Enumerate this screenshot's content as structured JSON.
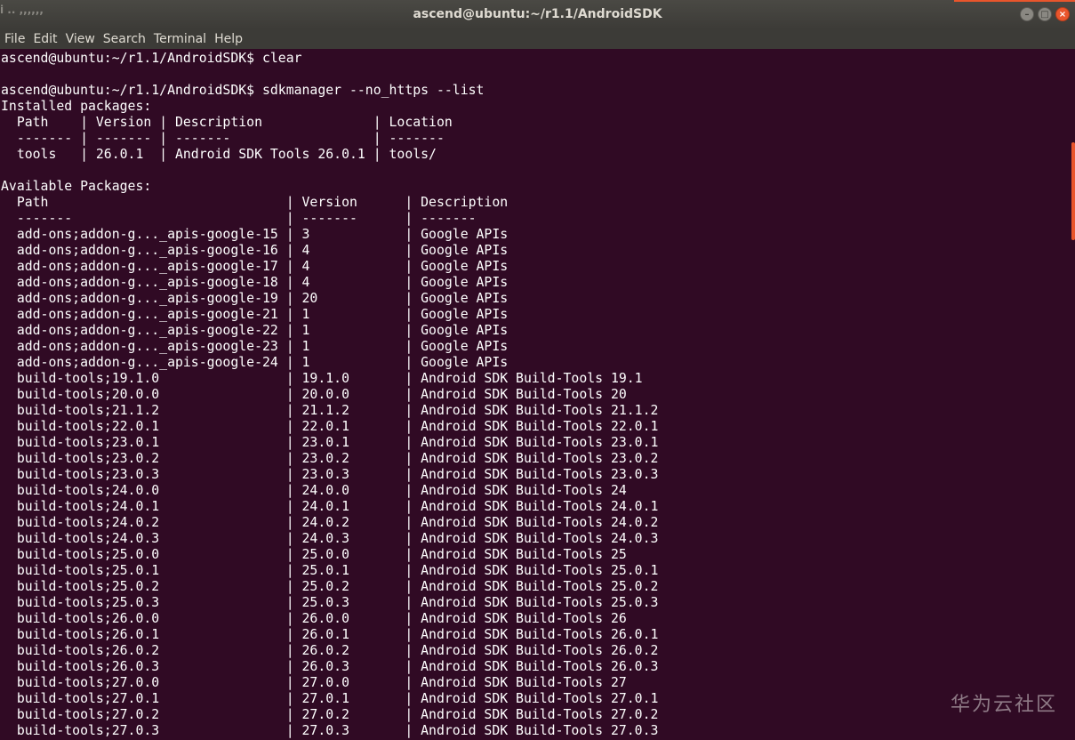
{
  "window": {
    "title": "ascend@ubuntu:~/r1.1/AndroidSDK",
    "corner_fragment": "i  .. ,,,,,,",
    "controls": {
      "minimize": "–",
      "maximize": "□",
      "close": "×"
    }
  },
  "menu": [
    "File",
    "Edit",
    "View",
    "Search",
    "Terminal",
    "Help"
  ],
  "terminal": {
    "lines": [
      "ascend@ubuntu:~/r1.1/AndroidSDK$ clear",
      "",
      "ascend@ubuntu:~/r1.1/AndroidSDK$ sdkmanager --no_https --list",
      "Installed packages:",
      "  Path    | Version | Description              | Location",
      "  ------- | ------- | -------                  | -------",
      "  tools   | 26.0.1  | Android SDK Tools 26.0.1 | tools/",
      "",
      "Available Packages:",
      "  Path                              | Version      | Description",
      "  -------                           | -------      | -------",
      "  add-ons;addon-g..._apis-google-15 | 3            | Google APIs",
      "  add-ons;addon-g..._apis-google-16 | 4            | Google APIs",
      "  add-ons;addon-g..._apis-google-17 | 4            | Google APIs",
      "  add-ons;addon-g..._apis-google-18 | 4            | Google APIs",
      "  add-ons;addon-g..._apis-google-19 | 20           | Google APIs",
      "  add-ons;addon-g..._apis-google-21 | 1            | Google APIs",
      "  add-ons;addon-g..._apis-google-22 | 1            | Google APIs",
      "  add-ons;addon-g..._apis-google-23 | 1            | Google APIs",
      "  add-ons;addon-g..._apis-google-24 | 1            | Google APIs",
      "  build-tools;19.1.0                | 19.1.0       | Android SDK Build-Tools 19.1",
      "  build-tools;20.0.0                | 20.0.0       | Android SDK Build-Tools 20",
      "  build-tools;21.1.2                | 21.1.2       | Android SDK Build-Tools 21.1.2",
      "  build-tools;22.0.1                | 22.0.1       | Android SDK Build-Tools 22.0.1",
      "  build-tools;23.0.1                | 23.0.1       | Android SDK Build-Tools 23.0.1",
      "  build-tools;23.0.2                | 23.0.2       | Android SDK Build-Tools 23.0.2",
      "  build-tools;23.0.3                | 23.0.3       | Android SDK Build-Tools 23.0.3",
      "  build-tools;24.0.0                | 24.0.0       | Android SDK Build-Tools 24",
      "  build-tools;24.0.1                | 24.0.1       | Android SDK Build-Tools 24.0.1",
      "  build-tools;24.0.2                | 24.0.2       | Android SDK Build-Tools 24.0.2",
      "  build-tools;24.0.3                | 24.0.3       | Android SDK Build-Tools 24.0.3",
      "  build-tools;25.0.0                | 25.0.0       | Android SDK Build-Tools 25",
      "  build-tools;25.0.1                | 25.0.1       | Android SDK Build-Tools 25.0.1",
      "  build-tools;25.0.2                | 25.0.2       | Android SDK Build-Tools 25.0.2",
      "  build-tools;25.0.3                | 25.0.3       | Android SDK Build-Tools 25.0.3",
      "  build-tools;26.0.0                | 26.0.0       | Android SDK Build-Tools 26",
      "  build-tools;26.0.1                | 26.0.1       | Android SDK Build-Tools 26.0.1",
      "  build-tools;26.0.2                | 26.0.2       | Android SDK Build-Tools 26.0.2",
      "  build-tools;26.0.3                | 26.0.3       | Android SDK Build-Tools 26.0.3",
      "  build-tools;27.0.0                | 27.0.0       | Android SDK Build-Tools 27",
      "  build-tools;27.0.1                | 27.0.1       | Android SDK Build-Tools 27.0.1",
      "  build-tools;27.0.2                | 27.0.2       | Android SDK Build-Tools 27.0.2",
      "  build-tools;27.0.3                | 27.0.3       | Android SDK Build-Tools 27.0.3"
    ]
  },
  "watermark": "华为云社区",
  "colors": {
    "terminal_bg": "#300a24",
    "terminal_fg": "#ffffff",
    "titlebar_bg": "#3c3b37",
    "accent": "#e9552c"
  }
}
